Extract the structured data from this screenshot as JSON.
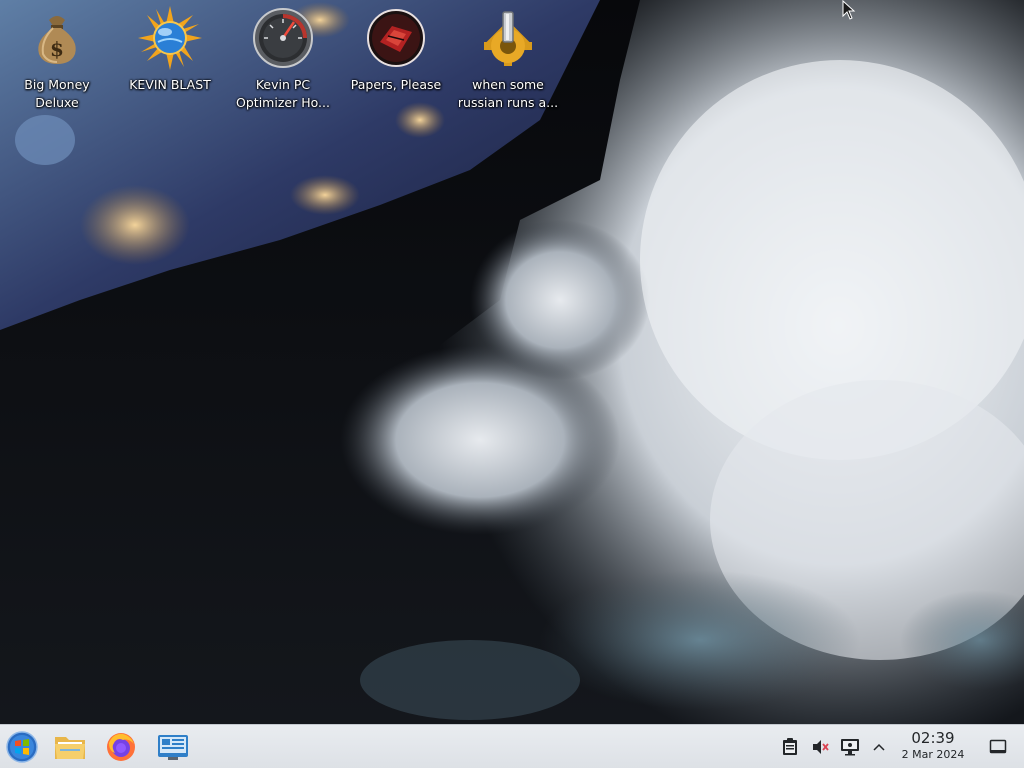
{
  "desktop": {
    "icons": [
      {
        "label_line1": "Big Money",
        "label_line2": "Deluxe",
        "icon": "money-bag-icon"
      },
      {
        "label_line1": "KEVIN BLAST",
        "label_line2": "",
        "icon": "sun-globe-icon"
      },
      {
        "label_line1": "Kevin PC",
        "label_line2": "Optimizer Ho...",
        "icon": "speedometer-icon"
      },
      {
        "label_line1": "Papers, Please",
        "label_line2": "",
        "icon": "papers-please-icon"
      },
      {
        "label_line1": "when some",
        "label_line2": "russian runs a...",
        "icon": "gear-icon"
      }
    ]
  },
  "taskbar": {
    "launchers": [
      "start-menu-icon",
      "file-manager-icon",
      "firefox-icon",
      "system-settings-icon"
    ],
    "tray": [
      "clipboard-icon",
      "volume-muted-icon",
      "network-monitor-icon",
      "chevron-up-icon"
    ],
    "clock": {
      "time": "02:39",
      "date": "2 Mar 2024"
    },
    "show_desktop": "show-desktop-icon"
  },
  "colors": {
    "taskbar_bg": "#e3e6ea",
    "label_text": "#ffffff",
    "clock_text": "#232629"
  }
}
